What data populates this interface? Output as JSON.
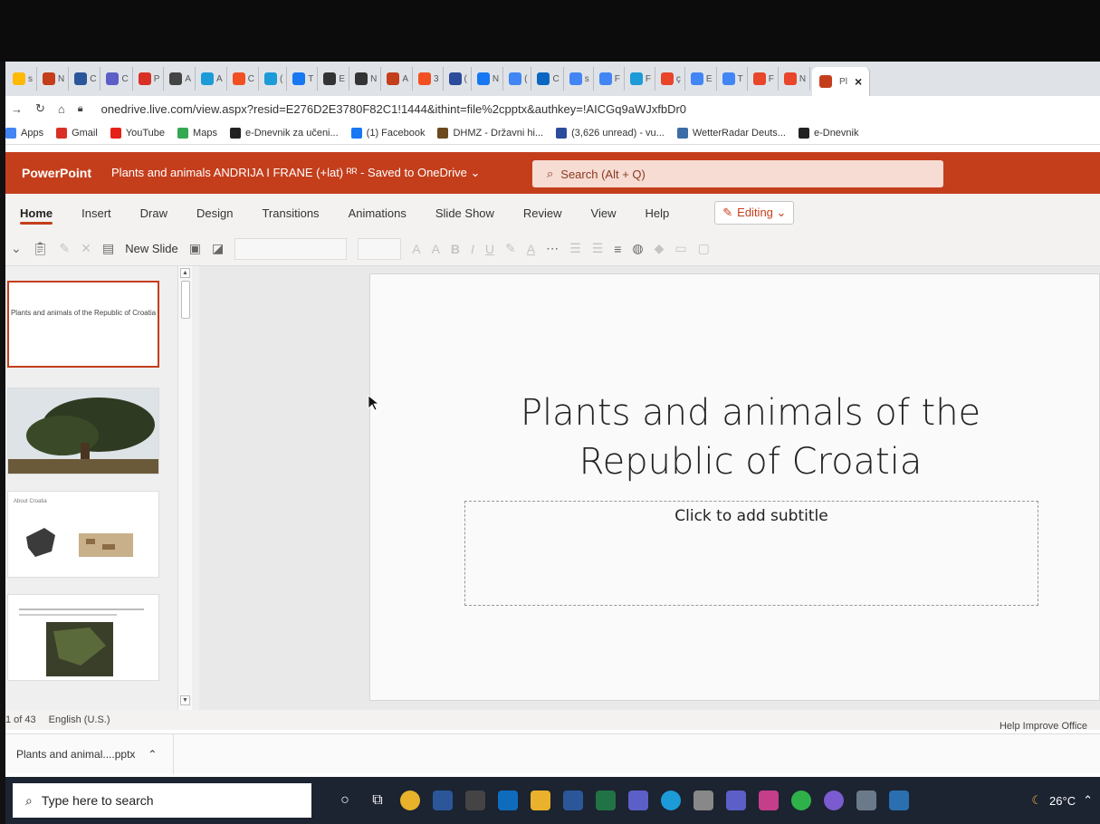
{
  "browser": {
    "tabs": [
      "s",
      "N",
      "C",
      "C",
      "P",
      "A",
      "A",
      "C",
      "(",
      "T",
      "E",
      "N",
      "A",
      "3",
      "(",
      "N",
      "(",
      "C",
      "s",
      "F",
      "F",
      "ç",
      "E",
      "T",
      "F",
      "N"
    ],
    "active_tab": {
      "label": "Pl",
      "close": "×"
    },
    "url": "onedrive.live.com/view.aspx?resid=E276D2E3780F82C1!1444&ithint=file%2cpptx&authkey=!AICGq9aWJxfbDr0",
    "bookmarks": [
      {
        "label": "Apps",
        "icon": "apps-grid-icon",
        "color": "#4285f4"
      },
      {
        "label": "Gmail",
        "icon": "gmail-icon",
        "color": "#d93025"
      },
      {
        "label": "YouTube",
        "icon": "youtube-icon",
        "color": "#e62117"
      },
      {
        "label": "Maps",
        "icon": "maps-pin-icon",
        "color": "#34a853"
      },
      {
        "label": "e-Dnevnik za učeni...",
        "icon": "ednevnik-icon",
        "color": "#222222"
      },
      {
        "label": "(1) Facebook",
        "icon": "facebook-icon",
        "color": "#1877f2"
      },
      {
        "label": "DHMZ - Državni hi...",
        "icon": "dhmz-icon",
        "color": "#6b4a1e"
      },
      {
        "label": "(3,626 unread) - vu...",
        "icon": "mail-icon",
        "color": "#2b4b9b"
      },
      {
        "label": "WetterRadar Deuts...",
        "icon": "weather-icon",
        "color": "#3a6ea5"
      },
      {
        "label": "e-Dnevnik",
        "icon": "ednevnik2-icon",
        "color": "#222222"
      }
    ]
  },
  "ppt": {
    "app_name": "PowerPoint",
    "doc_title": "Plants and animals ANDRIJA I FRANE (+lat) ᴿᴿ - Saved to OneDrive ⌄",
    "search_placeholder": "Search (Alt + Q)",
    "ribbon_tabs": [
      "Home",
      "Insert",
      "Draw",
      "Design",
      "Transitions",
      "Animations",
      "Slide Show",
      "Review",
      "View",
      "Help"
    ],
    "editing_label": "Editing ⌄",
    "new_slide_label": "New Slide",
    "slide_title": "Plants and animals of the Republic of Croatia",
    "subtitle_placeholder": "Click to add subtitle",
    "thumbnails": [
      {
        "title": "Plants and animals of the Republic of Croatia"
      },
      {
        "title": ""
      },
      {
        "title": "About Croatia"
      },
      {
        "title": ""
      }
    ],
    "status": {
      "slide_count": "1 of 43",
      "language": "English (U.S.)"
    },
    "help_improve": "Help Improve Office"
  },
  "downloads": {
    "file": "Plants and animal....pptx"
  },
  "taskbar": {
    "search_placeholder": "Type here to search",
    "temperature": "26°C"
  },
  "colors": {
    "accent": "#c43e1c",
    "taskbar": "#1c2331"
  }
}
